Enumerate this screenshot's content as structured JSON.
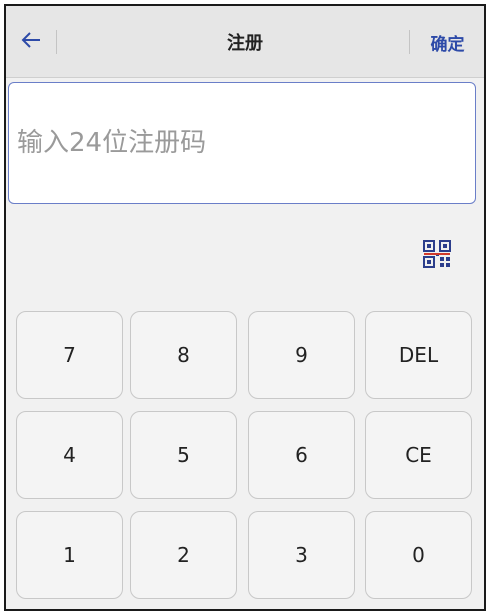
{
  "header": {
    "title": "注册",
    "confirm_label": "确定",
    "back_icon": "arrow-left-icon"
  },
  "registration": {
    "code_value": "",
    "placeholder": "输入24位注册码"
  },
  "scan": {
    "icon": "qr-code-icon"
  },
  "colors": {
    "accent": "#2d4aa8",
    "qr": "#2c3e8c",
    "qr_accent": "#d23a2a"
  },
  "keypad": {
    "row1": [
      "7",
      "8",
      "9",
      "DEL"
    ],
    "row2": [
      "4",
      "5",
      "6",
      "CE"
    ],
    "row3": [
      "1",
      "2",
      "3",
      "0"
    ]
  }
}
